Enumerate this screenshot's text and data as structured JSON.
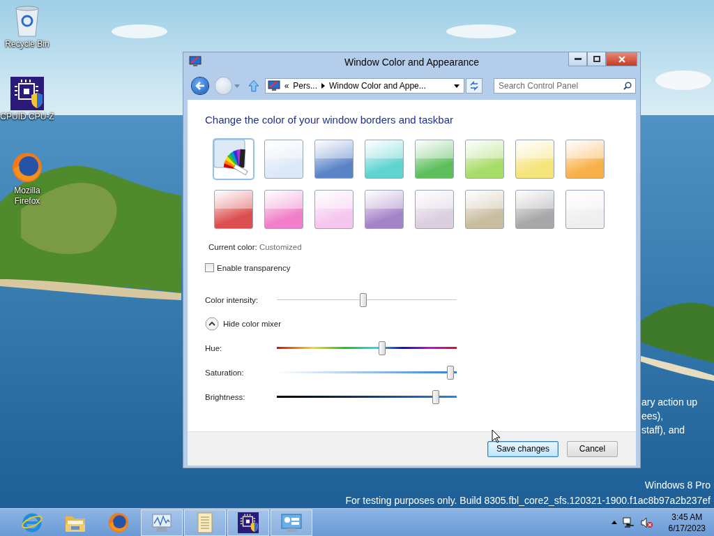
{
  "desktop_icons": [
    {
      "kind": "recycle-bin",
      "label": "Recycle Bin"
    },
    {
      "kind": "cpu",
      "label": "CPUID CPU-Z"
    },
    {
      "kind": "firefox",
      "label": "Mozilla Firefox"
    }
  ],
  "window": {
    "title": "Window Color and Appearance",
    "address": {
      "overflow": "«",
      "crumbs": [
        "Pers...",
        "Window Color and Appe..."
      ]
    },
    "search": {
      "placeholder": "Search Control Panel"
    },
    "heading": "Change the color of your window borders and taskbar",
    "swatches": [
      {
        "kind": "custom",
        "selected": true
      },
      {
        "kind": "color",
        "color": "#dde9f8",
        "selected": false
      },
      {
        "kind": "color",
        "color": "#5b84c8",
        "selected": false
      },
      {
        "kind": "color",
        "color": "#5fd3d0",
        "selected": false
      },
      {
        "kind": "color",
        "color": "#5cbf5c",
        "selected": false
      },
      {
        "kind": "color",
        "color": "#a6dc68",
        "selected": false
      },
      {
        "kind": "color",
        "color": "#f5e47a",
        "selected": false
      },
      {
        "kind": "color",
        "color": "#f8b04a",
        "selected": false
      },
      {
        "kind": "color",
        "color": "#dc4f50",
        "selected": false
      },
      {
        "kind": "color",
        "color": "#f07ec8",
        "selected": false
      },
      {
        "kind": "color",
        "color": "#f6c6ee",
        "selected": false
      },
      {
        "kind": "color",
        "color": "#a583c8",
        "selected": false
      },
      {
        "kind": "color",
        "color": "#dccfe0",
        "selected": false
      },
      {
        "kind": "color",
        "color": "#c9bda0",
        "selected": false
      },
      {
        "kind": "color",
        "color": "#a8a8a8",
        "selected": false
      },
      {
        "kind": "color",
        "color": "#efefef",
        "selected": false
      }
    ],
    "current_color": {
      "label": "Current color:",
      "value": "Customized"
    },
    "transparency": {
      "label": "Enable transparency",
      "checked": false
    },
    "intensity": {
      "label": "Color intensity:",
      "kind": "intensity",
      "level": 0.48
    },
    "mixer_toggle": {
      "label": "Hide color mixer",
      "expanded": true
    },
    "mixer": [
      {
        "label": "Hue:",
        "kind": "hue",
        "level": 0.59
      },
      {
        "label": "Saturation:",
        "kind": "saturation",
        "level": 0.985
      },
      {
        "label": "Brightness:",
        "kind": "brightness",
        "level": 0.9
      }
    ],
    "buttons": [
      {
        "label": "Save changes",
        "default": true
      },
      {
        "label": "Cancel",
        "default": false
      }
    ]
  },
  "background_text": [
    "ary action up",
    "ees),",
    "staff), and"
  ],
  "watermark": {
    "edition": "Windows 8 Pro",
    "build": "For testing purposes only. Build 8305.fbl_core2_sfs.120321-1900.f1ac8b97a2b237ef"
  },
  "taskbar": {
    "items": [
      {
        "kind": "ie",
        "running": false
      },
      {
        "kind": "explorer",
        "running": false
      },
      {
        "kind": "firefox",
        "running": false
      },
      {
        "kind": "monitor",
        "running": true
      },
      {
        "kind": "notepad",
        "running": true
      },
      {
        "kind": "cpu",
        "running": true
      },
      {
        "kind": "control-panel",
        "running": true
      }
    ],
    "time": "3:45 AM",
    "date": "6/17/2023"
  }
}
